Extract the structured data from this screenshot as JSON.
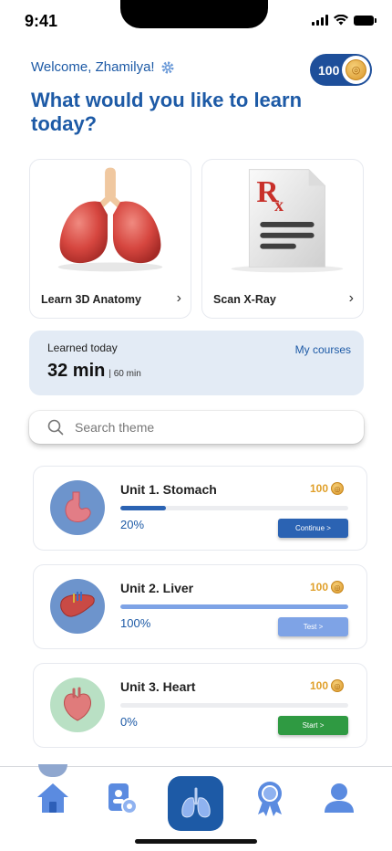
{
  "status": {
    "time": "9:41"
  },
  "header": {
    "welcome": "Welcome, Zhamilya!",
    "coins": "100",
    "title": "What would you like to learn today?"
  },
  "features": [
    {
      "label": "Learn 3D Anatomy",
      "icon": "lungs-icon"
    },
    {
      "label": "Scan X-Ray",
      "icon": "prescription-document-icon"
    }
  ],
  "learned": {
    "label": "Learned today",
    "link": "My courses",
    "time": "32 min",
    "goal": "| 60 min"
  },
  "search": {
    "placeholder": "Search theme",
    "value": ""
  },
  "units": [
    {
      "title": "Unit 1. Stomach",
      "points": "100",
      "progress_label": "20%",
      "progress": 0.2,
      "button": "Continue >",
      "button_color": "#2b63b3",
      "bar_color": "#2b63b3",
      "organ_bg": "#6d94cc"
    },
    {
      "title": "Unit 2. Liver",
      "points": "100",
      "progress_label": "100%",
      "progress": 1.0,
      "button": "Test >",
      "button_color": "#7ea3e6",
      "bar_color": "#7ea3e6",
      "organ_bg": "#6d94cc"
    },
    {
      "title": "Unit 3. Heart",
      "points": "100",
      "progress_label": "0%",
      "progress": 0.0,
      "button": "Start >",
      "button_color": "#2f9a42",
      "bar_color": "#2f9a42",
      "organ_bg": "#b9e0c4"
    }
  ],
  "nav": {
    "items": [
      "home-icon",
      "device-profile-icon",
      "lungs-icon",
      "award-icon",
      "user-icon"
    ],
    "active": "lungs-icon"
  },
  "colors": {
    "primary": "#1d5aa6",
    "coin": "#e0a02a"
  }
}
